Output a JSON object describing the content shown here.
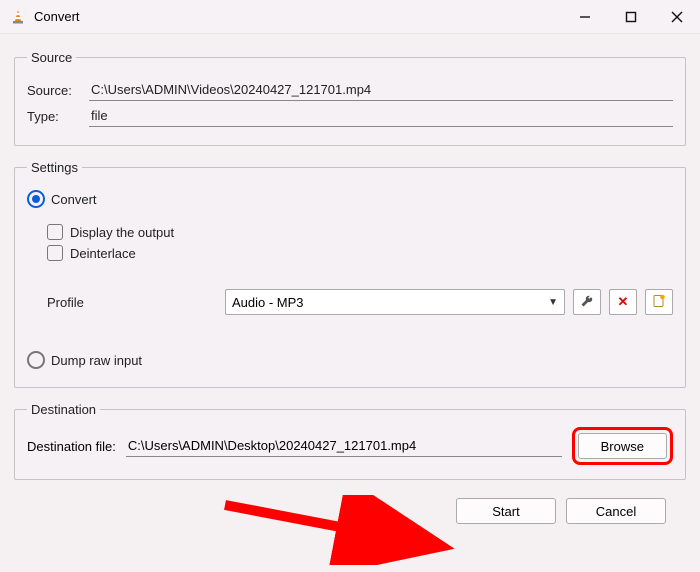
{
  "window": {
    "title": "Convert"
  },
  "source": {
    "legend": "Source",
    "source_label": "Source:",
    "source_value": "C:\\Users\\ADMIN\\Videos\\20240427_121701.mp4",
    "type_label": "Type:",
    "type_value": "file"
  },
  "settings": {
    "legend": "Settings",
    "convert_label": "Convert",
    "display_output_label": "Display the output",
    "deinterlace_label": "Deinterlace",
    "profile_label": "Profile",
    "profile_value": "Audio - MP3",
    "dump_label": "Dump raw input"
  },
  "destination": {
    "legend": "Destination",
    "file_label": "Destination file:",
    "file_value": "C:\\Users\\ADMIN\\Desktop\\20240427_121701.mp4",
    "browse_label": "Browse"
  },
  "buttons": {
    "start": "Start",
    "cancel": "Cancel"
  }
}
